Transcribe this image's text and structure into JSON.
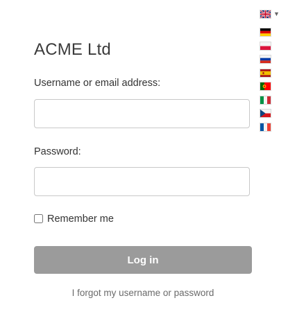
{
  "brand": {
    "title": "ACME Ltd"
  },
  "form": {
    "username_label": "Username or email address:",
    "username_value": "",
    "username_placeholder": "",
    "password_label": "Password:",
    "password_value": "",
    "password_placeholder": "",
    "remember_label": "Remember me",
    "remember_checked": false,
    "submit_label": "Log in",
    "forgot_link": "I forgot my username or password"
  },
  "language_selector": {
    "current": "en-gb-flag-icon",
    "options": [
      "de-flag-icon",
      "pl-flag-icon",
      "ru-flag-icon",
      "es-flag-icon",
      "pt-flag-icon",
      "it-flag-icon",
      "cz-flag-icon",
      "fr-flag-icon"
    ]
  },
  "colors": {
    "button_bg": "#9b9b9b",
    "button_text": "#ffffff",
    "input_border": "#c8c8c8",
    "link": "#6a6a6a"
  }
}
